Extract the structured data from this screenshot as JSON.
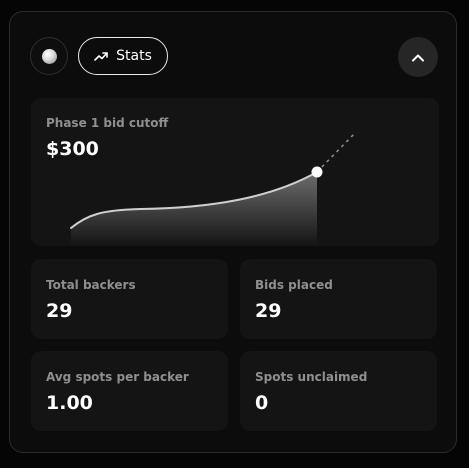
{
  "header": {
    "avatar_icon": "orb-icon",
    "stats_button": {
      "label": "Stats",
      "icon": "trending-up-icon"
    },
    "collapse_button": {
      "icon": "chevron-up-icon"
    }
  },
  "bid_cutoff": {
    "label": "Phase 1 bid cutoff",
    "value": "$300"
  },
  "stats": [
    {
      "label": "Total backers",
      "value": "29"
    },
    {
      "label": "Bids placed",
      "value": "29"
    },
    {
      "label": "Avg spots per backer",
      "value": "1.00"
    },
    {
      "label": "Spots unclaimed",
      "value": "0"
    }
  ],
  "colors": {
    "background": "#050505",
    "panel": "#0c0c0c",
    "card": "#141414",
    "label": "#8f8f8f",
    "value": "#ffffff"
  }
}
